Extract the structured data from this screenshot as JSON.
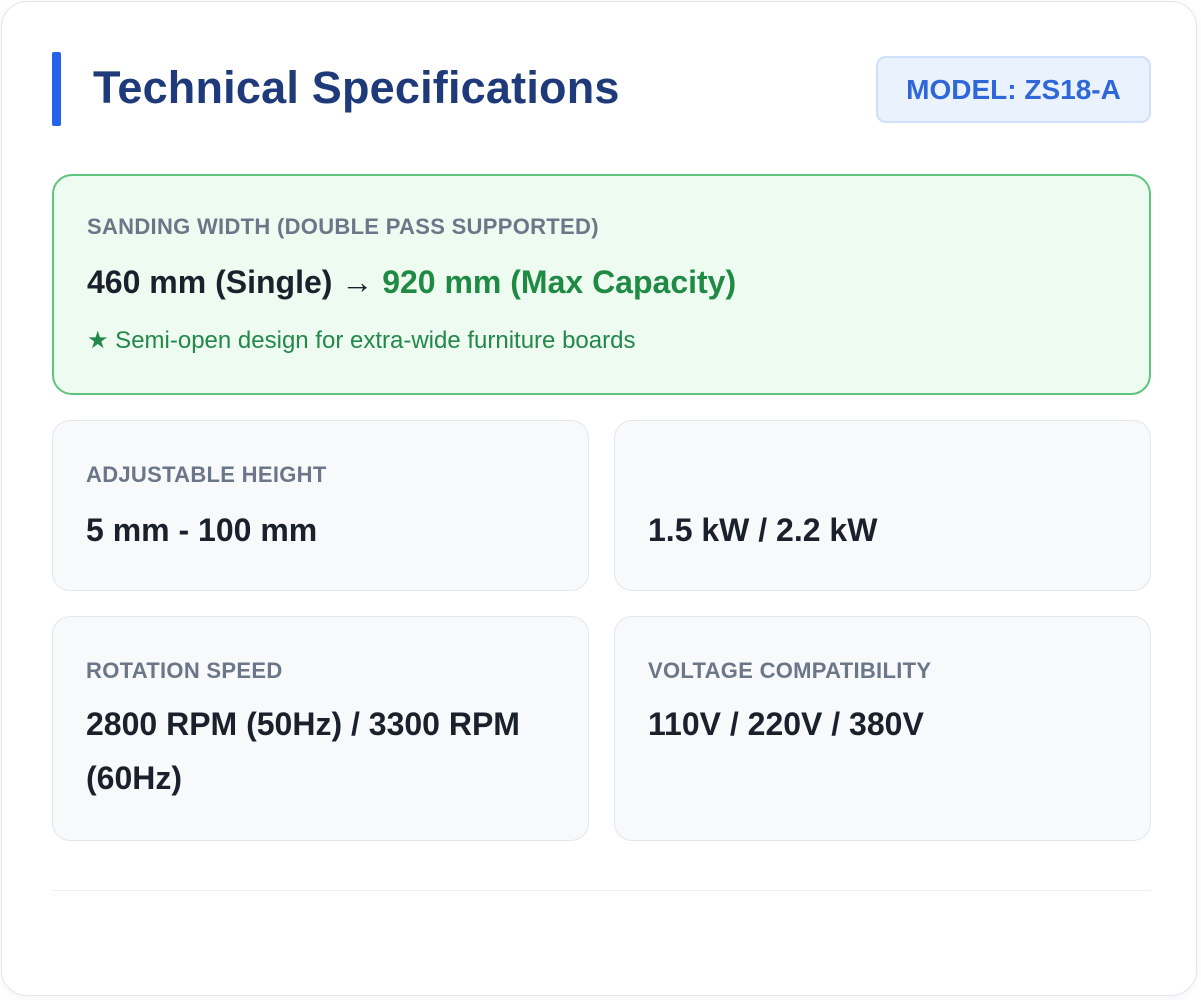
{
  "header": {
    "title": "Technical Specifications",
    "model_badge": "MODEL: ZS18-A"
  },
  "sanding_width": {
    "label": "SANDING WIDTH (DOUBLE PASS SUPPORTED)",
    "single_value": "460 mm (Single)",
    "arrow": "→",
    "max_value": "920 mm (Max Capacity)",
    "note": "★ Semi-open design for extra-wide furniture boards"
  },
  "specs": {
    "height": {
      "label": "ADJUSTABLE HEIGHT",
      "value": "5 mm - 100 mm"
    },
    "power": {
      "value": "1.5 kW / 2.2 kW"
    },
    "speed": {
      "label": "ROTATION SPEED",
      "value": "2800 RPM (50Hz) / 3300 RPM (60Hz)"
    },
    "voltage": {
      "label": "VOLTAGE COMPATIBILITY",
      "value": "110V / 220V / 380V"
    }
  },
  "colors": {
    "accent": "#2563eb",
    "title": "#1e3a7a",
    "highlight_green": "#1f8a44",
    "highlight_border": "#5fc47e"
  }
}
